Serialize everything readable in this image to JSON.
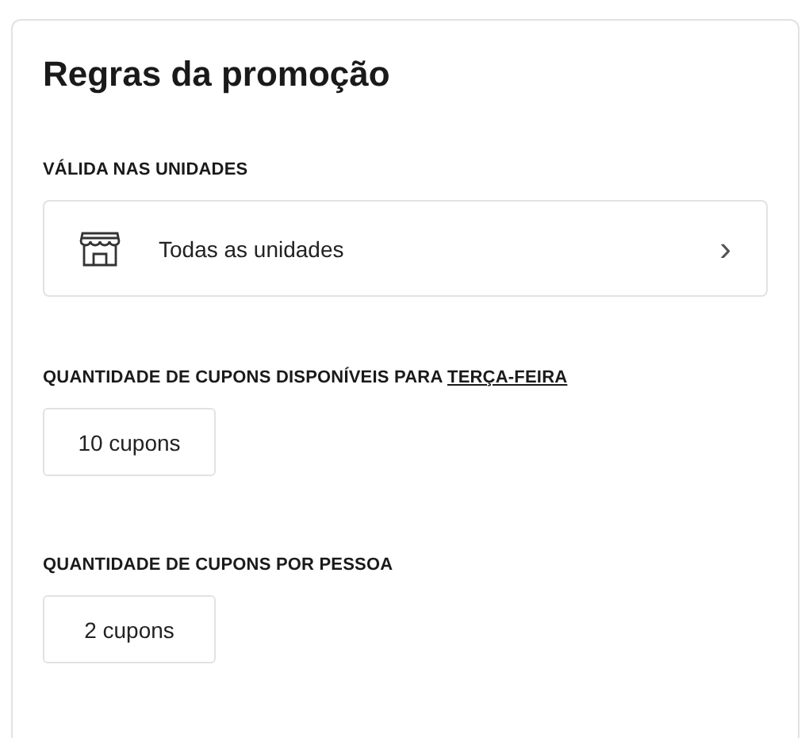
{
  "title": "Regras da promoção",
  "units": {
    "label": "VÁLIDA NAS UNIDADES",
    "value": "Todas as unidades",
    "chevron": "›"
  },
  "coupon_sections": [
    {
      "label": "QUANTIDADE DE CUPONS DISPONÍVEIS PARA ",
      "link": "TERÇA-FEIRA",
      "value": "10 cupons"
    },
    {
      "label": "QUANTIDADE DE CUPONS POR PESSOA",
      "value": "2 cupons"
    }
  ]
}
